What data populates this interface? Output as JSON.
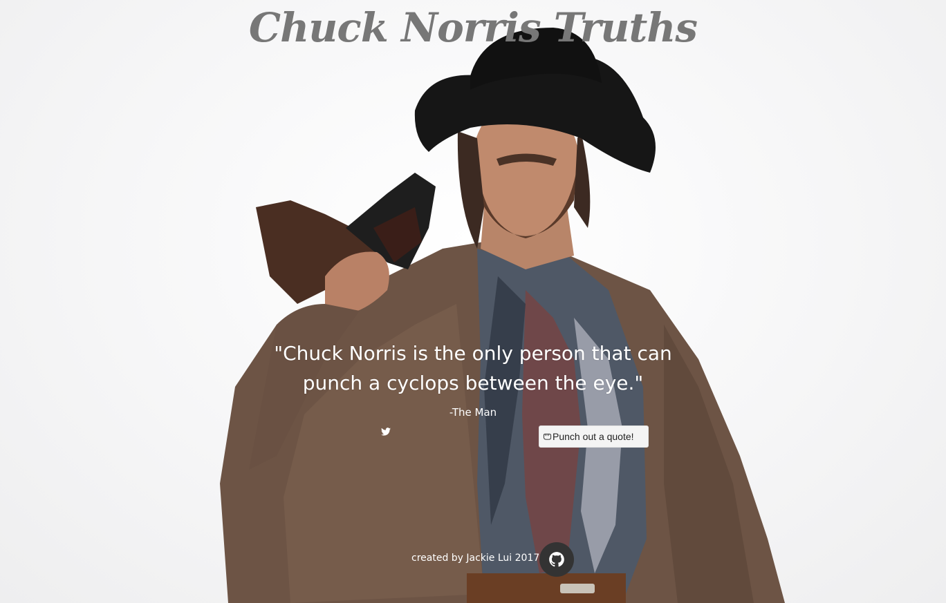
{
  "header": {
    "title": "Chuck Norris Truths"
  },
  "quote": {
    "text": "\"Chuck Norris is the only person that can punch a cyclops between the eye.\"",
    "author": "-The Man"
  },
  "actions": {
    "tweet_icon": "twitter-icon",
    "punch_label": "Punch out a quote!",
    "punch_icon": "fist-icon"
  },
  "footer": {
    "credit": "created by Jackie Lui 2017",
    "github_icon": "github-icon"
  },
  "colors": {
    "title": "#777777",
    "quote_text": "#ffffff",
    "button_bg": "#f4f4f4",
    "github_bg": "#333333"
  }
}
